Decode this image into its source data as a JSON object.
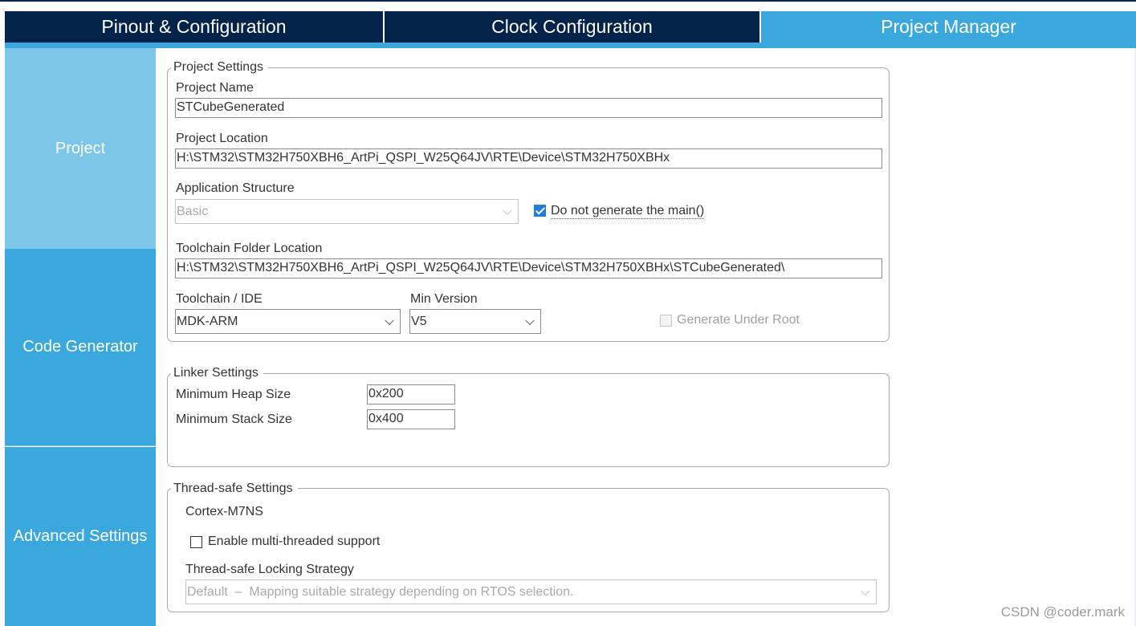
{
  "tabs": [
    {
      "label": "Pinout & Configuration",
      "active": false
    },
    {
      "label": "Clock Configuration",
      "active": false
    },
    {
      "label": "Project Manager",
      "active": true
    }
  ],
  "sidebar": {
    "items": [
      {
        "label": "Project",
        "selected": true
      },
      {
        "label": "Code Generator",
        "selected": false
      },
      {
        "label": "Advanced Settings",
        "selected": false
      }
    ]
  },
  "project_settings": {
    "title": "Project Settings",
    "project_name_label": "Project Name",
    "project_name_value": "STCubeGenerated",
    "project_location_label": "Project Location",
    "project_location_value": "H:\\STM32\\STM32H750XBH6_ArtPi_QSPI_W25Q64JV\\RTE\\Device\\STM32H750XBHx",
    "app_structure_label": "Application Structure",
    "app_structure_value": "Basic",
    "no_main_label": "Do not generate the main()",
    "no_main_checked": true,
    "toolchain_folder_label": "Toolchain Folder Location",
    "toolchain_folder_value": "H:\\STM32\\STM32H750XBH6_ArtPi_QSPI_W25Q64JV\\RTE\\Device\\STM32H750XBHx\\STCubeGenerated\\",
    "toolchain_label": "Toolchain / IDE",
    "toolchain_value": "MDK-ARM",
    "min_version_label": "Min Version",
    "min_version_value": "V5",
    "gen_under_root_label": "Generate Under Root",
    "gen_under_root_checked": false
  },
  "linker_settings": {
    "title": "Linker Settings",
    "heap_label": "Minimum Heap Size",
    "heap_value": "0x200",
    "stack_label": "Minimum Stack Size",
    "stack_value": "0x400"
  },
  "thread_safe_settings": {
    "title": "Thread-safe Settings",
    "core": "Cortex-M7NS",
    "multithread_label": "Enable multi-threaded support",
    "multithread_checked": false,
    "locking_label": "Thread-safe Locking Strategy",
    "locking_value": "Default  –  Mapping suitable strategy depending on RTOS selection."
  },
  "watermark": "CSDN @coder.mark",
  "colors": {
    "tab_dark": "#03234b",
    "tab_active": "#3aa8dc",
    "sidebar_selected": "#7dc6ea",
    "sidebar_normal": "#3aa8dc",
    "checkbox_checked": "#1f7ed6"
  }
}
